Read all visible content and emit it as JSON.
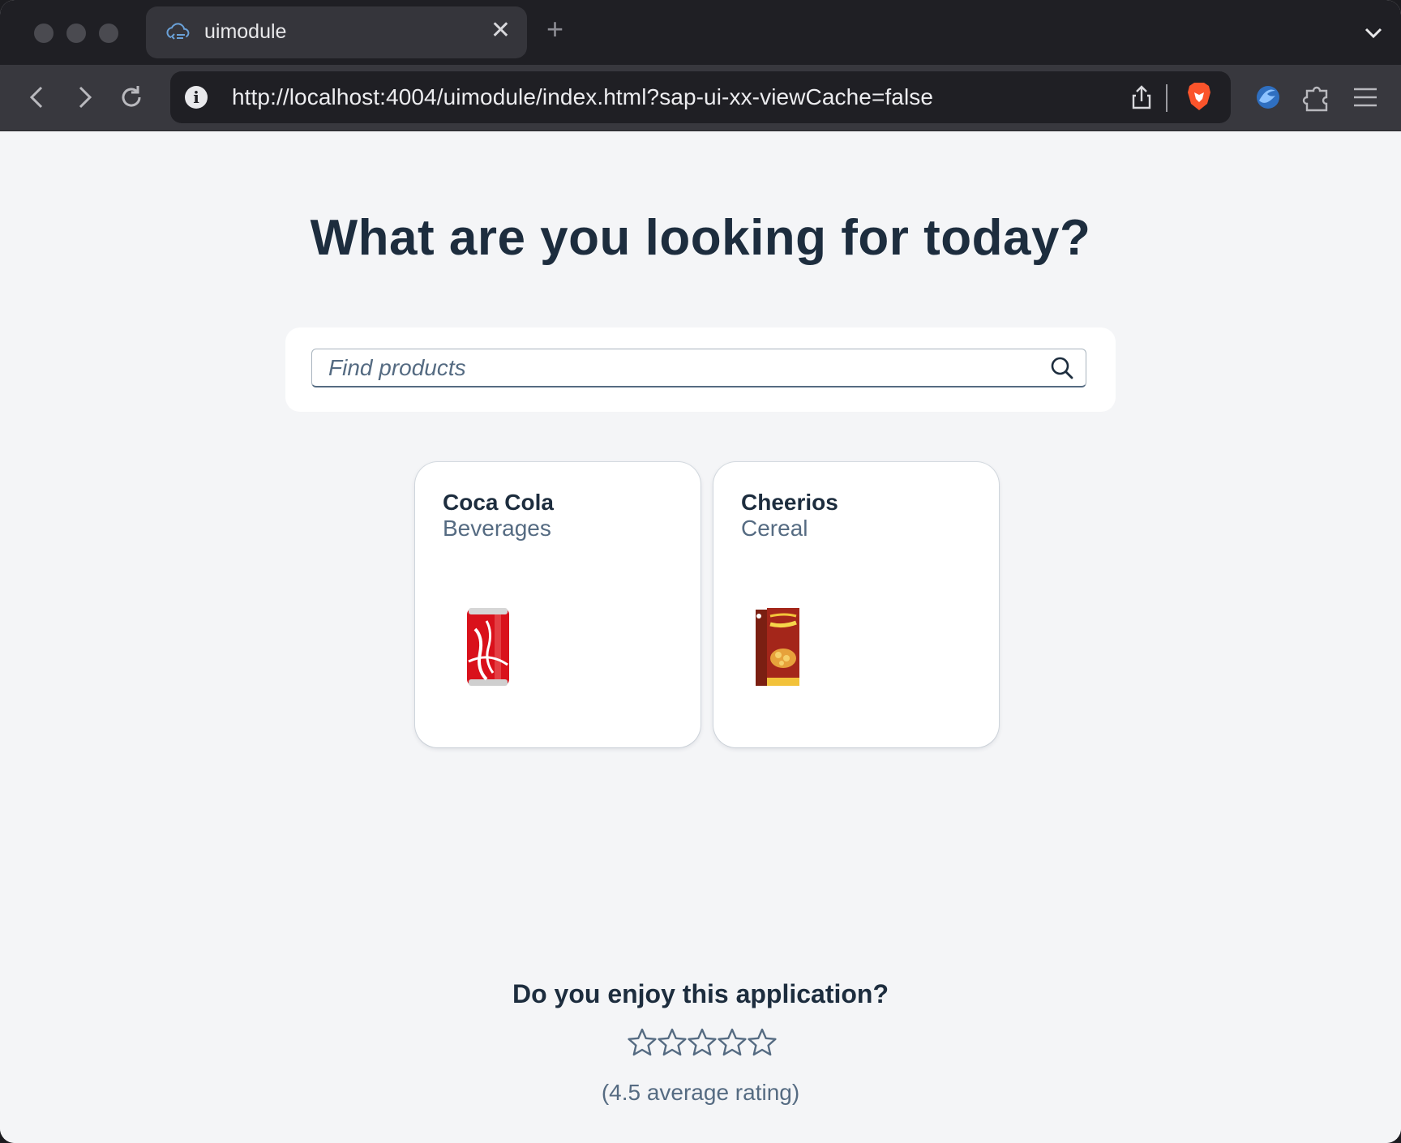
{
  "browser": {
    "tab": {
      "title": "uimodule",
      "icon": "cloud-code-icon"
    },
    "url": "http://localhost:4004/uimodule/index.html?sap-ui-xx-viewCache=false"
  },
  "page": {
    "headline": "What are you looking for today?",
    "search": {
      "placeholder": "Find products",
      "value": ""
    },
    "products": [
      {
        "name": "Coca Cola",
        "category": "Beverages",
        "image": "coca-cola-can-image"
      },
      {
        "name": "Cheerios",
        "category": "Cereal",
        "image": "cheerios-box-image"
      }
    ],
    "feedback": {
      "question": "Do you enjoy this application?",
      "stars_total": 5,
      "stars_selected": 0,
      "average_text": "(4.5 average rating)"
    }
  },
  "colors": {
    "heading": "#1d2d3e",
    "secondary_text": "#556b82",
    "page_background": "#f4f5f7",
    "brave_orange": "#fb542b"
  }
}
